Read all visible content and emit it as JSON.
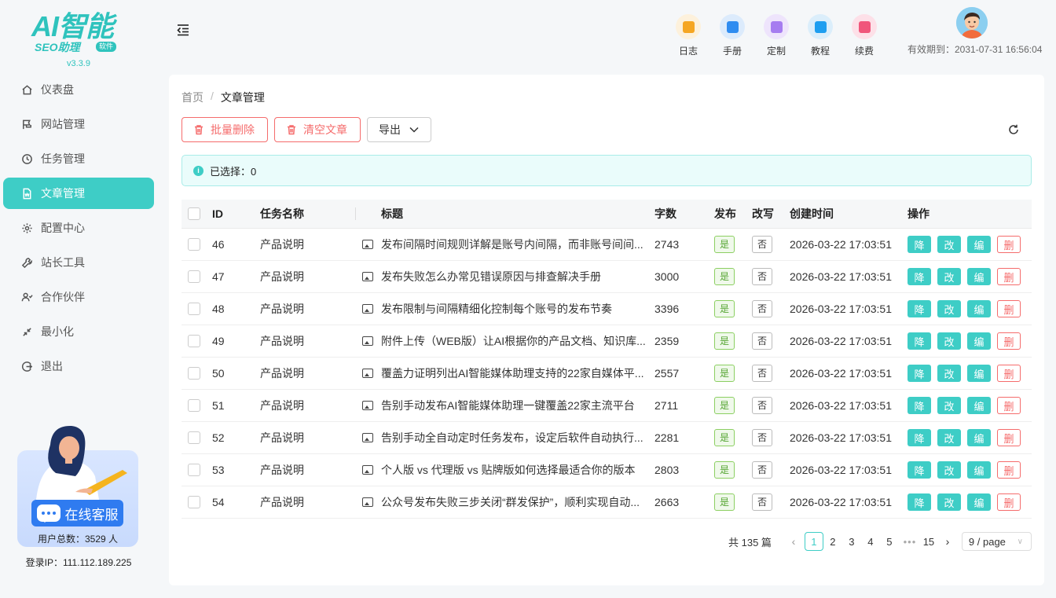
{
  "app": {
    "logo_main": "AI智能",
    "logo_sub": "SEO助理",
    "logo_tag": "软件",
    "version": "v3.3.9"
  },
  "sidebar": {
    "items": [
      {
        "label": "仪表盘",
        "icon": "home-icon",
        "active": false
      },
      {
        "label": "网站管理",
        "icon": "flag-icon",
        "active": false
      },
      {
        "label": "任务管理",
        "icon": "clock-icon",
        "active": false
      },
      {
        "label": "文章管理",
        "icon": "document-icon",
        "active": true
      },
      {
        "label": "配置中心",
        "icon": "gear-icon",
        "active": false
      },
      {
        "label": "站长工具",
        "icon": "wrench-icon",
        "active": false
      },
      {
        "label": "合作伙伴",
        "icon": "partners-icon",
        "active": false
      },
      {
        "label": "最小化",
        "icon": "minimize-icon",
        "active": false
      },
      {
        "label": "退出",
        "icon": "logout-icon",
        "active": false
      }
    ],
    "service_label": "在线客服",
    "user_total": "用户总数：3529 人",
    "login_ip": "登录IP：111.112.189.225"
  },
  "header": {
    "nav": [
      {
        "label": "日志",
        "icon": "log-icon",
        "color": "#f5a623",
        "bg": "#fdf1dc"
      },
      {
        "label": "手册",
        "icon": "manual-icon",
        "color": "#2f8cf0",
        "bg": "#dcebfc"
      },
      {
        "label": "定制",
        "icon": "custom-icon",
        "color": "#a67cf0",
        "bg": "#eee4fc"
      },
      {
        "label": "教程",
        "icon": "tutorial-icon",
        "color": "#1e9ef0",
        "bg": "#dbeefb"
      },
      {
        "label": "续费",
        "icon": "renew-icon",
        "color": "#f0567b",
        "bg": "#fde0e8"
      }
    ],
    "expire": "有效期到：2031-07-31 16:56:04"
  },
  "breadcrumb": {
    "home": "首页",
    "separator": "/",
    "current": "文章管理"
  },
  "toolbar": {
    "batch_delete": "批量删除",
    "clear_articles": "清空文章",
    "export": "导出"
  },
  "alert": {
    "selected_text": "已选择：0"
  },
  "table": {
    "columns": [
      "ID",
      "任务名称",
      "标题",
      "字数",
      "发布",
      "改写",
      "创建时间",
      "操作"
    ],
    "actions": [
      "降",
      "改",
      "编",
      "删"
    ],
    "rows": [
      {
        "id": "46",
        "task": "产品说明",
        "title": "发布间隔时间规则详解是账号内间隔，而非账号间间...",
        "words": "2743",
        "published": "是",
        "rewritten": "否",
        "created": "2026-03-22 17:03:51"
      },
      {
        "id": "47",
        "task": "产品说明",
        "title": "发布失败怎么办常见错误原因与排查解决手册",
        "words": "3000",
        "published": "是",
        "rewritten": "否",
        "created": "2026-03-22 17:03:51"
      },
      {
        "id": "48",
        "task": "产品说明",
        "title": "发布限制与间隔精细化控制每个账号的发布节奏",
        "words": "3396",
        "published": "是",
        "rewritten": "否",
        "created": "2026-03-22 17:03:51"
      },
      {
        "id": "49",
        "task": "产品说明",
        "title": "附件上传（WEB版）让AI根据你的产品文档、知识库...",
        "words": "2359",
        "published": "是",
        "rewritten": "否",
        "created": "2026-03-22 17:03:51"
      },
      {
        "id": "50",
        "task": "产品说明",
        "title": "覆盖力证明列出AI智能媒体助理支持的22家自媒体平...",
        "words": "2557",
        "published": "是",
        "rewritten": "否",
        "created": "2026-03-22 17:03:51"
      },
      {
        "id": "51",
        "task": "产品说明",
        "title": "告别手动发布AI智能媒体助理一键覆盖22家主流平台",
        "words": "2711",
        "published": "是",
        "rewritten": "否",
        "created": "2026-03-22 17:03:51"
      },
      {
        "id": "52",
        "task": "产品说明",
        "title": "告别手动全自动定时任务发布，设定后软件自动执行...",
        "words": "2281",
        "published": "是",
        "rewritten": "否",
        "created": "2026-03-22 17:03:51"
      },
      {
        "id": "53",
        "task": "产品说明",
        "title": "个人版 vs 代理版 vs 贴牌版如何选择最适合你的版本",
        "words": "2803",
        "published": "是",
        "rewritten": "否",
        "created": "2026-03-22 17:03:51"
      },
      {
        "id": "54",
        "task": "产品说明",
        "title": "公众号发布失败三步关闭“群发保护”，顺利实现自动...",
        "words": "2663",
        "published": "是",
        "rewritten": "否",
        "created": "2026-03-22 17:03:51"
      }
    ]
  },
  "pagination": {
    "total": "共 135 篇",
    "pages": [
      "1",
      "2",
      "3",
      "4",
      "5"
    ],
    "ellipsis": "•••",
    "last": "15",
    "current": "1",
    "page_size": "9 / page"
  },
  "colors": {
    "accent": "#3ecdc6",
    "danger": "#f56c6c",
    "success": "#55a532"
  }
}
